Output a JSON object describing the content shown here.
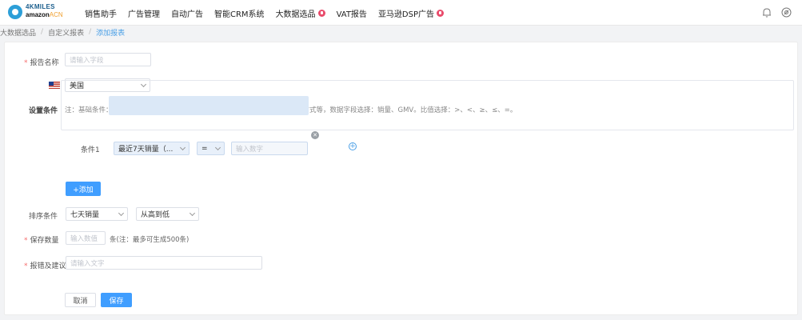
{
  "logo": {
    "line1": "4KMILES",
    "line2": "amazon",
    "line2_suffix": "ACN"
  },
  "nav": [
    {
      "label": "销售助手",
      "hot": false
    },
    {
      "label": "广告管理",
      "hot": false
    },
    {
      "label": "自动广告",
      "hot": false
    },
    {
      "label": "智能CRM系统",
      "hot": false
    },
    {
      "label": "大数据选品",
      "hot": true
    },
    {
      "label": "VAT报告",
      "hot": false
    },
    {
      "label": "亚马逊DSP广告",
      "hot": true
    }
  ],
  "header_icons": {
    "notify": "bell-icon",
    "settings": "gear-icon"
  },
  "breadcrumb": [
    "大数据选品",
    "自定义报表",
    "添加报表"
  ],
  "form": {
    "report_name": {
      "label": "报告名称",
      "placeholder": "请输入字段"
    },
    "marketplace": {
      "selected": "美国",
      "flag": "us-flag-icon"
    },
    "conditions": {
      "label": "设置条件",
      "note": "注：基础条件：销量、销售额、单价、评分、评论数、品牌、店铺、类目、配送方式等，数据字段选择：销量、GMV。比值选择：>、<、≥、≤、=。",
      "items": [
        {
          "label": "条件1",
          "field": "最近7天销量（...",
          "operator": "=",
          "value_placeholder": "输入数字"
        }
      ],
      "add_label": "+添加"
    },
    "sort": {
      "label": "排序条件",
      "field": "七天销量",
      "order": "从高到低"
    },
    "save_count": {
      "label": "保存数量",
      "placeholder": "输入数值",
      "note": "条(注：最多可生成500条)"
    },
    "feedback": {
      "label": "报错及建议",
      "placeholder": "请输入文字"
    },
    "cancel_label": "取消",
    "save_label": "保存"
  },
  "colors": {
    "primary": "#409eff",
    "required": "#f56c6c",
    "hot": "#e94b6b",
    "condition_bg": "#dbe8f7"
  }
}
